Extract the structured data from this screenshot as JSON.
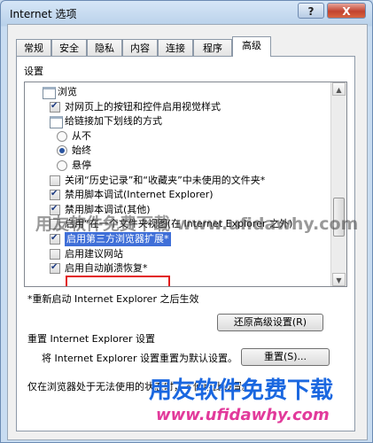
{
  "window": {
    "title": "Internet 选项",
    "help_label": "?",
    "close_label": "X"
  },
  "tabs": [
    "常规",
    "安全",
    "隐私",
    "内容",
    "连接",
    "程序",
    "高级"
  ],
  "settings": {
    "group_label": "设置",
    "items": [
      {
        "type": "folder",
        "indent": 0,
        "text": "浏览"
      },
      {
        "type": "checkbox",
        "indent": 1,
        "checked": true,
        "text": "对网页上的按钮和控件启用视觉样式"
      },
      {
        "type": "folder",
        "indent": 1,
        "text": "给链接加下划线的方式"
      },
      {
        "type": "radio",
        "indent": 2,
        "checked": false,
        "text": "从不"
      },
      {
        "type": "radio",
        "indent": 2,
        "checked": true,
        "text": "始终"
      },
      {
        "type": "radio",
        "indent": 2,
        "checked": false,
        "text": "悬停"
      },
      {
        "type": "checkbox",
        "indent": 1,
        "checked": false,
        "text": "关闭“历史记录”和“收藏夹”中未使用的文件夹*"
      },
      {
        "type": "checkbox",
        "indent": 1,
        "checked": true,
        "text": "禁用脚本调试(Internet Explorer)"
      },
      {
        "type": "checkbox",
        "indent": 1,
        "checked": true,
        "text": "禁用脚本调试(其他)"
      },
      {
        "type": "checkbox",
        "indent": 1,
        "checked": false,
        "text": "启用“在一个文件夹视图(在 Internet Explorer 之外)"
      },
      {
        "type": "checkbox",
        "indent": 1,
        "checked": true,
        "text": "启用第三方浏览器扩展*",
        "highlighted": true
      },
      {
        "type": "checkbox",
        "indent": 1,
        "checked": false,
        "text": "启用建议网站"
      },
      {
        "type": "checkbox",
        "indent": 1,
        "checked": true,
        "text": "启用自动崩溃恢复*"
      }
    ],
    "note": "*重新启动 Internet Explorer 之后生效",
    "restore_button": "还原高级设置(R)"
  },
  "reset_group": {
    "label": "重置 Internet Explorer 设置",
    "description": "将 Internet Explorer 设置重置为默认设置。",
    "reset_button": "重置(S)...",
    "hint": "仅在浏览器处于无法使用的状态时，才使用此设置。"
  },
  "watermarks": {
    "middle": "用友软件免费下载  www.ufidawhy.com",
    "bottom_title": "用友软件免费下载",
    "bottom_url": "www.ufidawhy.com"
  }
}
